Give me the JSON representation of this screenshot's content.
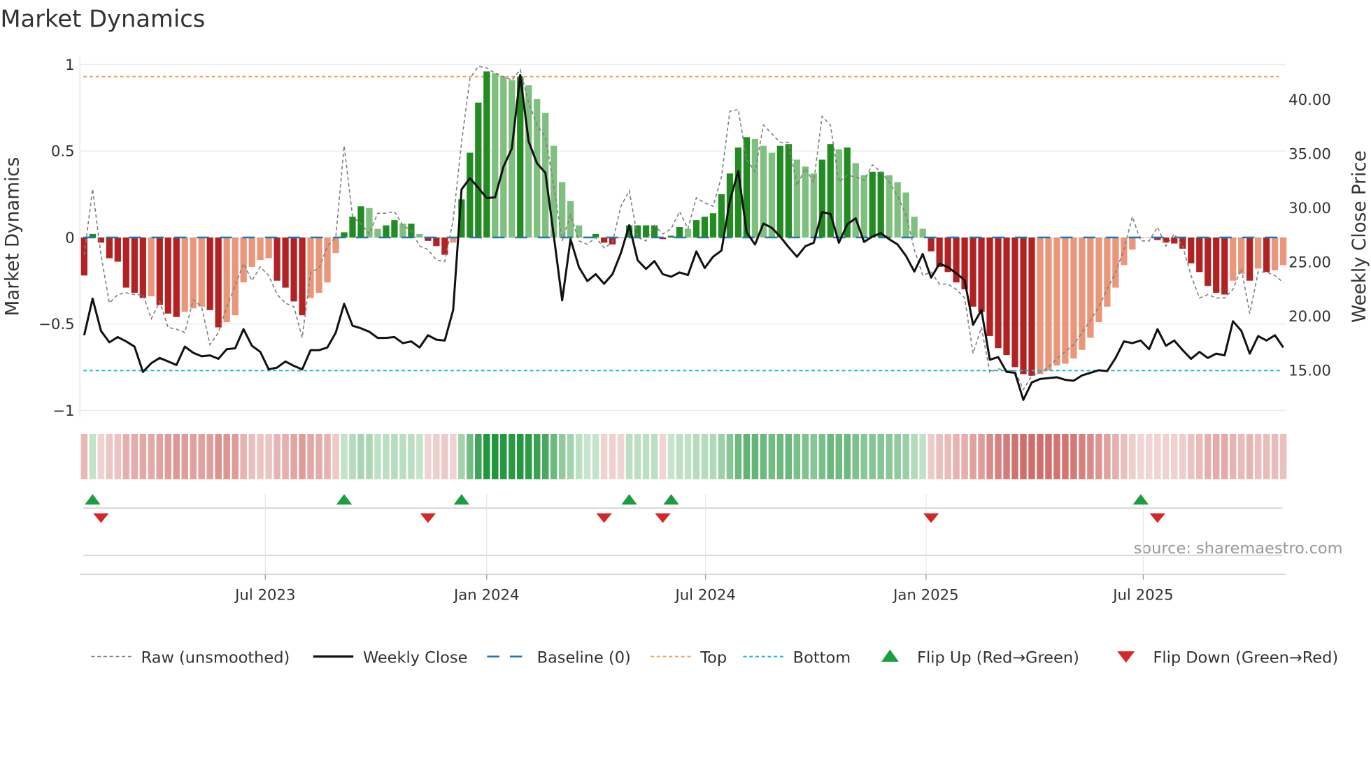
{
  "title": "Market Dynamics",
  "source": "source: sharemaestro.com",
  "colors": {
    "green_strong": "#228b22",
    "green_weak": "#7fbf7f",
    "red_strong": "#b22222",
    "red_weak": "#e9967a",
    "baseline": "#1f77b4",
    "top": "#f4a460",
    "bottom": "#17becf",
    "raw": "#808080",
    "close": "#111111",
    "flip_up": "#1a9e3f",
    "flip_down": "#d62728"
  },
  "chart_data": {
    "type": "bar",
    "title": "Market Dynamics",
    "ylabel": "Market Dynamics",
    "y2label": "Weekly Close Price",
    "ylim": [
      -1.04,
      1.045
    ],
    "y2lim": [
      10.65,
      43.95
    ],
    "yticks": [
      {
        "v": 1,
        "label": "1"
      },
      {
        "v": 0.5,
        "label": "0.5"
      },
      {
        "v": 0,
        "label": "0"
      },
      {
        "v": -0.5,
        "label": "−0.5"
      },
      {
        "v": -1,
        "label": "−1"
      }
    ],
    "y2ticks": [
      {
        "v": 15,
        "label": "15.00"
      },
      {
        "v": 20,
        "label": "20.00"
      },
      {
        "v": 25,
        "label": "25.00"
      },
      {
        "v": 30,
        "label": "30.00"
      },
      {
        "v": 35,
        "label": "35.00"
      },
      {
        "v": 40,
        "label": "40.00"
      }
    ],
    "xticks": [
      {
        "week": 21.6,
        "label": "Jul 2023"
      },
      {
        "week": 48.0,
        "label": "Jan 2024"
      },
      {
        "week": 74.1,
        "label": "Jul 2024"
      },
      {
        "week": 100.4,
        "label": "Jan 2025"
      },
      {
        "week": 126.3,
        "label": "Jul 2025"
      }
    ],
    "top_level": 0.93,
    "bottom_level": -0.77,
    "baseline": 0,
    "bars": [
      -0.22,
      0.02,
      -0.03,
      -0.12,
      -0.14,
      -0.29,
      -0.32,
      -0.35,
      -0.34,
      -0.39,
      -0.44,
      -0.46,
      -0.43,
      -0.41,
      -0.4,
      -0.42,
      -0.52,
      -0.49,
      -0.45,
      -0.26,
      -0.17,
      -0.13,
      -0.12,
      -0.25,
      -0.29,
      -0.37,
      -0.45,
      -0.35,
      -0.32,
      -0.26,
      -0.09,
      0.03,
      0.12,
      0.18,
      0.17,
      0.05,
      0.07,
      0.1,
      0.08,
      0.08,
      0.02,
      -0.02,
      -0.05,
      -0.1,
      -0.03,
      0.22,
      0.49,
      0.78,
      0.96,
      0.95,
      0.93,
      0.91,
      0.93,
      0.88,
      0.8,
      0.72,
      0.53,
      0.32,
      0.21,
      0.07,
      0.005,
      0.02,
      -0.03,
      -0.04,
      -0.005,
      0.07,
      0.07,
      0.07,
      0.07,
      -0.01,
      0.01,
      0.06,
      0.05,
      0.1,
      0.12,
      0.14,
      0.25,
      0.37,
      0.52,
      0.58,
      0.57,
      0.53,
      0.49,
      0.53,
      0.54,
      0.45,
      0.41,
      0.37,
      0.45,
      0.54,
      0.51,
      0.52,
      0.43,
      0.36,
      0.38,
      0.38,
      0.36,
      0.32,
      0.26,
      0.12,
      0.05,
      -0.08,
      -0.17,
      -0.2,
      -0.26,
      -0.3,
      -0.4,
      -0.43,
      -0.57,
      -0.64,
      -0.68,
      -0.75,
      -0.79,
      -0.8,
      -0.79,
      -0.77,
      -0.74,
      -0.73,
      -0.7,
      -0.65,
      -0.58,
      -0.49,
      -0.4,
      -0.29,
      -0.16,
      -0.07,
      -0.005,
      -0.003,
      -0.015,
      -0.03,
      -0.035,
      -0.065,
      -0.15,
      -0.2,
      -0.28,
      -0.32,
      -0.33,
      -0.25,
      -0.21,
      -0.25,
      -0.18,
      -0.2,
      -0.19,
      -0.16
    ],
    "raw": [
      -0.1,
      0.28,
      -0.1,
      -0.38,
      -0.33,
      -0.32,
      -0.33,
      -0.33,
      -0.47,
      -0.37,
      -0.52,
      -0.53,
      -0.55,
      -0.36,
      -0.4,
      -0.62,
      -0.55,
      -0.4,
      -0.28,
      -0.15,
      -0.25,
      -0.17,
      -0.22,
      -0.33,
      -0.38,
      -0.4,
      -0.58,
      -0.2,
      -0.18,
      -0.05,
      0.0,
      0.53,
      0.12,
      0.08,
      0.02,
      0.14,
      0.14,
      0.15,
      0.07,
      0.04,
      -0.05,
      -0.07,
      -0.13,
      -0.14,
      0.1,
      0.55,
      0.92,
      0.99,
      0.98,
      0.95,
      0.93,
      0.91,
      0.97,
      0.78,
      0.65,
      0.58,
      0.3,
      -0.02,
      0.13,
      -0.02,
      -0.04,
      0.0,
      -0.06,
      -0.03,
      0.18,
      0.27,
      0.0,
      -0.02,
      0.07,
      0.02,
      0.05,
      0.15,
      0.05,
      0.23,
      0.2,
      0.18,
      0.35,
      0.73,
      0.74,
      0.45,
      0.38,
      0.65,
      0.6,
      0.55,
      0.55,
      0.3,
      0.4,
      0.32,
      0.7,
      0.65,
      0.32,
      0.36,
      0.35,
      0.33,
      0.42,
      0.38,
      0.32,
      0.24,
      0.13,
      -0.07,
      -0.22,
      -0.2,
      -0.27,
      -0.27,
      -0.3,
      -0.35,
      -0.67,
      -0.52,
      -0.78,
      -0.76,
      -0.77,
      -0.77,
      -0.88,
      -0.8,
      -0.78,
      -0.75,
      -0.7,
      -0.66,
      -0.62,
      -0.55,
      -0.48,
      -0.4,
      -0.3,
      -0.2,
      -0.07,
      0.12,
      -0.02,
      -0.02,
      0.06,
      -0.05,
      0.02,
      -0.05,
      -0.22,
      -0.35,
      -0.33,
      -0.35,
      -0.35,
      -0.3,
      -0.18,
      -0.44,
      -0.2,
      -0.2,
      -0.22,
      -0.26
    ],
    "close": [
      18.23,
      21.61,
      18.63,
      17.58,
      18.06,
      17.66,
      17.18,
      14.84,
      15.65,
      16.13,
      15.81,
      15.48,
      17.18,
      16.61,
      16.29,
      16.37,
      16.05,
      16.94,
      17.02,
      18.79,
      17.26,
      16.69,
      15.08,
      15.24,
      15.81,
      15.4,
      15.08,
      16.85,
      16.85,
      17.1,
      18.47,
      21.13,
      19.11,
      18.87,
      18.55,
      17.98,
      17.98,
      18.06,
      17.5,
      17.66,
      17.1,
      18.23,
      17.82,
      17.74,
      20.56,
      31.69,
      32.74,
      31.85,
      30.89,
      30.97,
      33.79,
      35.48,
      42.26,
      36.13,
      34.11,
      33.23,
      27.42,
      21.45,
      27.1,
      24.52,
      23.23,
      23.87,
      22.98,
      23.87,
      25.81,
      28.39,
      25.16,
      24.35,
      25.08,
      23.87,
      23.63,
      24.03,
      23.79,
      25.97,
      24.44,
      25.48,
      26.05,
      30.65,
      33.39,
      27.74,
      26.61,
      28.55,
      28.15,
      27.34,
      26.37,
      25.48,
      26.45,
      26.77,
      29.6,
      29.44,
      26.77,
      28.47,
      29.03,
      26.85,
      27.34,
      27.66,
      27.1,
      26.61,
      25.56,
      24.11,
      25.73,
      23.55,
      24.84,
      24.52,
      23.95,
      23.31,
      19.19,
      20.56,
      15.97,
      16.21,
      14.84,
      14.76,
      12.26,
      13.87,
      14.19,
      14.27,
      14.35,
      14.11,
      14.03,
      14.52,
      14.76,
      15.0,
      14.92,
      16.13,
      17.66,
      17.5,
      17.74,
      16.94,
      18.79,
      17.26,
      17.74,
      16.85,
      16.05,
      16.69,
      16.13,
      16.53,
      16.37,
      19.52,
      18.63,
      16.53,
      18.15,
      17.74,
      18.23,
      17.1
    ],
    "flip_up_weeks": [
      2,
      32,
      46,
      66,
      71,
      127
    ],
    "flip_down_weeks": [
      3,
      42,
      63,
      70,
      102,
      129
    ],
    "legend": {
      "placement": "bottom",
      "items": [
        {
          "key": "raw",
          "label": "Raw (unsmoothed)"
        },
        {
          "key": "close",
          "label": "Weekly Close"
        },
        {
          "key": "baseline",
          "label": "Baseline (0)"
        },
        {
          "key": "top",
          "label": "Top"
        },
        {
          "key": "bottom",
          "label": "Bottom"
        },
        {
          "key": "flip_up",
          "label": "Flip Up (Red→Green)"
        },
        {
          "key": "flip_down",
          "label": "Flip Down (Green→Red)"
        }
      ]
    }
  }
}
